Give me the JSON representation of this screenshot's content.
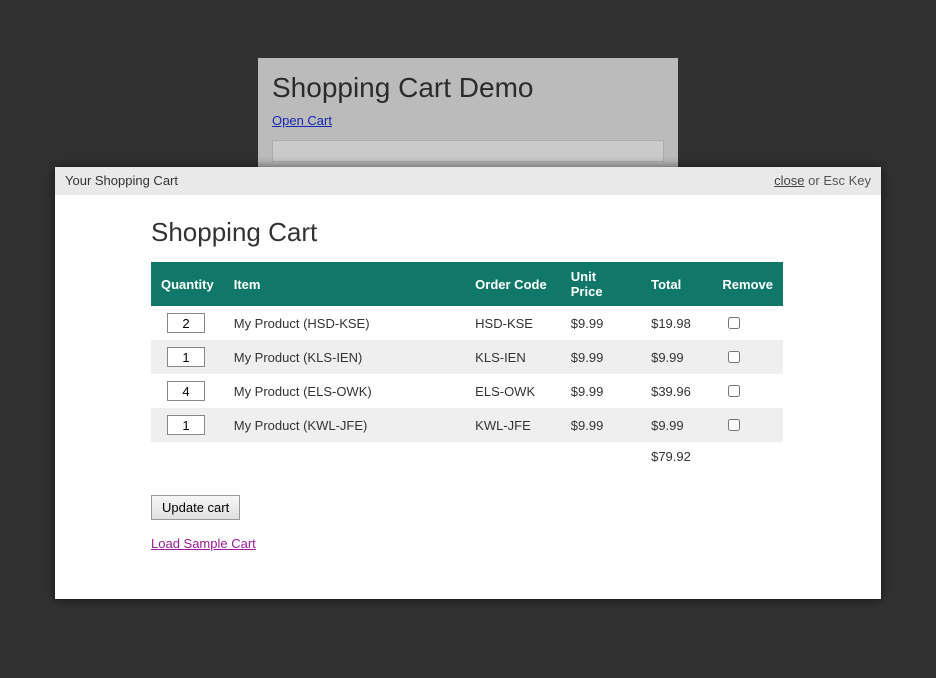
{
  "background_page": {
    "heading": "Shopping Cart Demo",
    "open_cart_link": "Open Cart"
  },
  "modal": {
    "header_title": "Your Shopping Cart",
    "close_label": "close",
    "close_hint": " or Esc Key",
    "heading": "Shopping Cart",
    "columns": {
      "quantity": "Quantity",
      "item": "Item",
      "order_code": "Order Code",
      "unit_price": "Unit Price",
      "total": "Total",
      "remove": "Remove"
    },
    "rows": [
      {
        "qty": "2",
        "item": "My Product (HSD-KSE)",
        "code": "HSD-KSE",
        "price": "$9.99",
        "total": "$19.98"
      },
      {
        "qty": "1",
        "item": "My Product (KLS-IEN)",
        "code": "KLS-IEN",
        "price": "$9.99",
        "total": "$9.99"
      },
      {
        "qty": "4",
        "item": "My Product (ELS-OWK)",
        "code": "ELS-OWK",
        "price": "$9.99",
        "total": "$39.96"
      },
      {
        "qty": "1",
        "item": "My Product (KWL-JFE)",
        "code": "KWL-JFE",
        "price": "$9.99",
        "total": "$9.99"
      }
    ],
    "grand_total": "$79.92",
    "update_button": "Update cart",
    "load_sample": "Load Sample Cart"
  }
}
